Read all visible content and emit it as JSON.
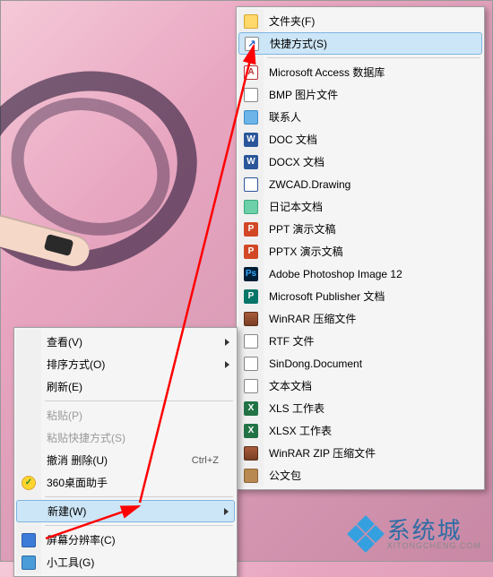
{
  "left_menu": {
    "items": [
      {
        "label": "查看(V)",
        "has_submenu": true
      },
      {
        "label": "排序方式(O)",
        "has_submenu": true
      },
      {
        "label": "刷新(E)"
      }
    ],
    "items2": [
      {
        "label": "粘贴(P)",
        "disabled": true
      },
      {
        "label": "粘贴快捷方式(S)",
        "disabled": true
      },
      {
        "label": "撤消 删除(U)",
        "shortcut": "Ctrl+Z"
      },
      {
        "label": "360桌面助手",
        "icon": "i-360"
      }
    ],
    "items3": [
      {
        "label": "新建(W)",
        "has_submenu": true,
        "highlighted": true
      }
    ],
    "items4": [
      {
        "label": "屏幕分辨率(C)",
        "icon": "i-screen"
      },
      {
        "label": "小工具(G)",
        "icon": "i-gadget"
      }
    ]
  },
  "right_menu": {
    "items": [
      {
        "label": "文件夹(F)",
        "icon": "i-folder"
      },
      {
        "label": "快捷方式(S)",
        "icon": "i-shortcut",
        "highlighted": true
      }
    ],
    "items2": [
      {
        "label": "Microsoft Access 数据库",
        "icon": "i-access",
        "t": "A"
      },
      {
        "label": "BMP 图片文件",
        "icon": "i-bmp"
      },
      {
        "label": "联系人",
        "icon": "i-contact"
      },
      {
        "label": "DOC 文档",
        "icon": "i-doc",
        "t": "W"
      },
      {
        "label": "DOCX 文档",
        "icon": "i-docx",
        "t": "W"
      },
      {
        "label": "ZWCAD.Drawing",
        "icon": "i-zwcad"
      },
      {
        "label": "日记本文档",
        "icon": "i-diary"
      },
      {
        "label": "PPT 演示文稿",
        "icon": "i-ppt",
        "t": "P"
      },
      {
        "label": "PPTX 演示文稿",
        "icon": "i-pptx",
        "t": "P"
      },
      {
        "label": "Adobe Photoshop Image 12",
        "icon": "i-ps",
        "t": "Ps"
      },
      {
        "label": "Microsoft Publisher 文档",
        "icon": "i-pub",
        "t": "P"
      },
      {
        "label": "WinRAR 压缩文件",
        "icon": "i-rar"
      },
      {
        "label": "RTF 文件",
        "icon": "i-rtf"
      },
      {
        "label": "SinDong.Document",
        "icon": "i-sindong"
      },
      {
        "label": "文本文档",
        "icon": "i-txt"
      },
      {
        "label": "XLS 工作表",
        "icon": "i-xls",
        "t": "X"
      },
      {
        "label": "XLSX 工作表",
        "icon": "i-xlsx",
        "t": "X"
      },
      {
        "label": "WinRAR ZIP 压缩文件",
        "icon": "i-zip"
      },
      {
        "label": "公文包",
        "icon": "i-briefcase"
      }
    ]
  },
  "watermark": {
    "main": "系统城",
    "sub": "XITONGCHENG.COM"
  }
}
